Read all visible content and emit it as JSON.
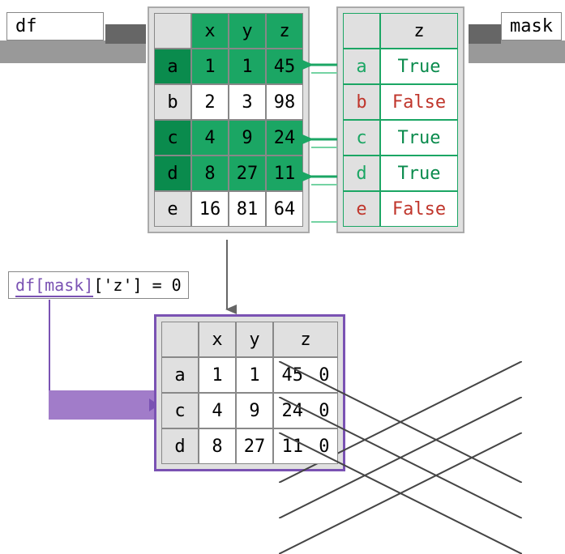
{
  "labels": {
    "df": "df",
    "mask": "mask",
    "code": "df[mask]['z'] = 0"
  },
  "df": {
    "columns": [
      "x",
      "y",
      "z"
    ],
    "index": [
      "a",
      "b",
      "c",
      "d",
      "e"
    ],
    "rows": [
      [
        1,
        1,
        45
      ],
      [
        2,
        3,
        98
      ],
      [
        4,
        9,
        24
      ],
      [
        8,
        27,
        11
      ],
      [
        16,
        81,
        64
      ]
    ],
    "selected_rows": [
      "a",
      "c",
      "d"
    ]
  },
  "mask": {
    "column": "z",
    "index": [
      "a",
      "b",
      "c",
      "d",
      "e"
    ],
    "values": [
      true,
      false,
      true,
      true,
      false
    ]
  },
  "result": {
    "columns": [
      "x",
      "y",
      "z"
    ],
    "index": [
      "a",
      "c",
      "d"
    ],
    "rows": [
      {
        "x": 1,
        "y": 1,
        "z_old": 45,
        "z_new": 0
      },
      {
        "x": 4,
        "y": 9,
        "z_old": 24,
        "z_new": 0
      },
      {
        "x": 8,
        "y": 27,
        "z_old": 11,
        "z_new": 0
      }
    ]
  }
}
